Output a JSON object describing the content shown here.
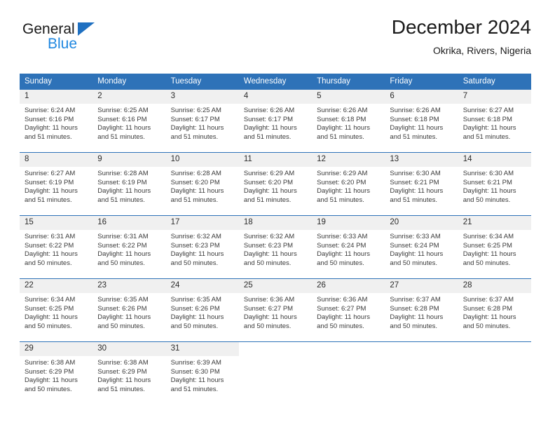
{
  "brand": {
    "name_dark": "General",
    "name_blue": "Blue",
    "triangle_color": "#1f70c1",
    "blue_text_color": "#1f87e0"
  },
  "header": {
    "title": "December 2024",
    "subtitle": "Okrika, Rivers, Nigeria"
  },
  "colors": {
    "header_blue": "#2e72b8",
    "daynum_band": "#f0f0f0",
    "text": "#3a3a3a"
  },
  "calendar": {
    "weekday_headers": [
      "Sunday",
      "Monday",
      "Tuesday",
      "Wednesday",
      "Thursday",
      "Friday",
      "Saturday"
    ],
    "weeks": [
      [
        {
          "day": "1",
          "sunrise": "Sunrise: 6:24 AM",
          "sunset": "Sunset: 6:16 PM",
          "daylight1": "Daylight: 11 hours",
          "daylight2": "and 51 minutes."
        },
        {
          "day": "2",
          "sunrise": "Sunrise: 6:25 AM",
          "sunset": "Sunset: 6:16 PM",
          "daylight1": "Daylight: 11 hours",
          "daylight2": "and 51 minutes."
        },
        {
          "day": "3",
          "sunrise": "Sunrise: 6:25 AM",
          "sunset": "Sunset: 6:17 PM",
          "daylight1": "Daylight: 11 hours",
          "daylight2": "and 51 minutes."
        },
        {
          "day": "4",
          "sunrise": "Sunrise: 6:26 AM",
          "sunset": "Sunset: 6:17 PM",
          "daylight1": "Daylight: 11 hours",
          "daylight2": "and 51 minutes."
        },
        {
          "day": "5",
          "sunrise": "Sunrise: 6:26 AM",
          "sunset": "Sunset: 6:18 PM",
          "daylight1": "Daylight: 11 hours",
          "daylight2": "and 51 minutes."
        },
        {
          "day": "6",
          "sunrise": "Sunrise: 6:26 AM",
          "sunset": "Sunset: 6:18 PM",
          "daylight1": "Daylight: 11 hours",
          "daylight2": "and 51 minutes."
        },
        {
          "day": "7",
          "sunrise": "Sunrise: 6:27 AM",
          "sunset": "Sunset: 6:18 PM",
          "daylight1": "Daylight: 11 hours",
          "daylight2": "and 51 minutes."
        }
      ],
      [
        {
          "day": "8",
          "sunrise": "Sunrise: 6:27 AM",
          "sunset": "Sunset: 6:19 PM",
          "daylight1": "Daylight: 11 hours",
          "daylight2": "and 51 minutes."
        },
        {
          "day": "9",
          "sunrise": "Sunrise: 6:28 AM",
          "sunset": "Sunset: 6:19 PM",
          "daylight1": "Daylight: 11 hours",
          "daylight2": "and 51 minutes."
        },
        {
          "day": "10",
          "sunrise": "Sunrise: 6:28 AM",
          "sunset": "Sunset: 6:20 PM",
          "daylight1": "Daylight: 11 hours",
          "daylight2": "and 51 minutes."
        },
        {
          "day": "11",
          "sunrise": "Sunrise: 6:29 AM",
          "sunset": "Sunset: 6:20 PM",
          "daylight1": "Daylight: 11 hours",
          "daylight2": "and 51 minutes."
        },
        {
          "day": "12",
          "sunrise": "Sunrise: 6:29 AM",
          "sunset": "Sunset: 6:20 PM",
          "daylight1": "Daylight: 11 hours",
          "daylight2": "and 51 minutes."
        },
        {
          "day": "13",
          "sunrise": "Sunrise: 6:30 AM",
          "sunset": "Sunset: 6:21 PM",
          "daylight1": "Daylight: 11 hours",
          "daylight2": "and 51 minutes."
        },
        {
          "day": "14",
          "sunrise": "Sunrise: 6:30 AM",
          "sunset": "Sunset: 6:21 PM",
          "daylight1": "Daylight: 11 hours",
          "daylight2": "and 50 minutes."
        }
      ],
      [
        {
          "day": "15",
          "sunrise": "Sunrise: 6:31 AM",
          "sunset": "Sunset: 6:22 PM",
          "daylight1": "Daylight: 11 hours",
          "daylight2": "and 50 minutes."
        },
        {
          "day": "16",
          "sunrise": "Sunrise: 6:31 AM",
          "sunset": "Sunset: 6:22 PM",
          "daylight1": "Daylight: 11 hours",
          "daylight2": "and 50 minutes."
        },
        {
          "day": "17",
          "sunrise": "Sunrise: 6:32 AM",
          "sunset": "Sunset: 6:23 PM",
          "daylight1": "Daylight: 11 hours",
          "daylight2": "and 50 minutes."
        },
        {
          "day": "18",
          "sunrise": "Sunrise: 6:32 AM",
          "sunset": "Sunset: 6:23 PM",
          "daylight1": "Daylight: 11 hours",
          "daylight2": "and 50 minutes."
        },
        {
          "day": "19",
          "sunrise": "Sunrise: 6:33 AM",
          "sunset": "Sunset: 6:24 PM",
          "daylight1": "Daylight: 11 hours",
          "daylight2": "and 50 minutes."
        },
        {
          "day": "20",
          "sunrise": "Sunrise: 6:33 AM",
          "sunset": "Sunset: 6:24 PM",
          "daylight1": "Daylight: 11 hours",
          "daylight2": "and 50 minutes."
        },
        {
          "day": "21",
          "sunrise": "Sunrise: 6:34 AM",
          "sunset": "Sunset: 6:25 PM",
          "daylight1": "Daylight: 11 hours",
          "daylight2": "and 50 minutes."
        }
      ],
      [
        {
          "day": "22",
          "sunrise": "Sunrise: 6:34 AM",
          "sunset": "Sunset: 6:25 PM",
          "daylight1": "Daylight: 11 hours",
          "daylight2": "and 50 minutes."
        },
        {
          "day": "23",
          "sunrise": "Sunrise: 6:35 AM",
          "sunset": "Sunset: 6:26 PM",
          "daylight1": "Daylight: 11 hours",
          "daylight2": "and 50 minutes."
        },
        {
          "day": "24",
          "sunrise": "Sunrise: 6:35 AM",
          "sunset": "Sunset: 6:26 PM",
          "daylight1": "Daylight: 11 hours",
          "daylight2": "and 50 minutes."
        },
        {
          "day": "25",
          "sunrise": "Sunrise: 6:36 AM",
          "sunset": "Sunset: 6:27 PM",
          "daylight1": "Daylight: 11 hours",
          "daylight2": "and 50 minutes."
        },
        {
          "day": "26",
          "sunrise": "Sunrise: 6:36 AM",
          "sunset": "Sunset: 6:27 PM",
          "daylight1": "Daylight: 11 hours",
          "daylight2": "and 50 minutes."
        },
        {
          "day": "27",
          "sunrise": "Sunrise: 6:37 AM",
          "sunset": "Sunset: 6:28 PM",
          "daylight1": "Daylight: 11 hours",
          "daylight2": "and 50 minutes."
        },
        {
          "day": "28",
          "sunrise": "Sunrise: 6:37 AM",
          "sunset": "Sunset: 6:28 PM",
          "daylight1": "Daylight: 11 hours",
          "daylight2": "and 50 minutes."
        }
      ],
      [
        {
          "day": "29",
          "sunrise": "Sunrise: 6:38 AM",
          "sunset": "Sunset: 6:29 PM",
          "daylight1": "Daylight: 11 hours",
          "daylight2": "and 50 minutes."
        },
        {
          "day": "30",
          "sunrise": "Sunrise: 6:38 AM",
          "sunset": "Sunset: 6:29 PM",
          "daylight1": "Daylight: 11 hours",
          "daylight2": "and 51 minutes."
        },
        {
          "day": "31",
          "sunrise": "Sunrise: 6:39 AM",
          "sunset": "Sunset: 6:30 PM",
          "daylight1": "Daylight: 11 hours",
          "daylight2": "and 51 minutes."
        },
        {
          "day": "",
          "sunrise": "",
          "sunset": "",
          "daylight1": "",
          "daylight2": ""
        },
        {
          "day": "",
          "sunrise": "",
          "sunset": "",
          "daylight1": "",
          "daylight2": ""
        },
        {
          "day": "",
          "sunrise": "",
          "sunset": "",
          "daylight1": "",
          "daylight2": ""
        },
        {
          "day": "",
          "sunrise": "",
          "sunset": "",
          "daylight1": "",
          "daylight2": ""
        }
      ]
    ]
  }
}
